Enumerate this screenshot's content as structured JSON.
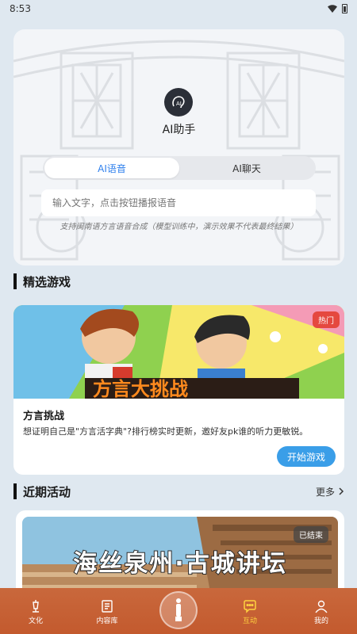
{
  "status": {
    "time": "8:53"
  },
  "ai": {
    "title": "AI助手",
    "tabs": [
      {
        "label": "AI语音",
        "active": true
      },
      {
        "label": "AI聊天",
        "active": false
      }
    ],
    "input_placeholder": "输入文字，点击按钮播报语音",
    "note": "支持闽南语方言语音合成（模型训练中，演示效果不代表最终结果）"
  },
  "games": {
    "section_title": "精选游戏",
    "badge": "热门",
    "banner_text": "方言大挑战",
    "title": "方言挑战",
    "desc": "想证明自己是\"方言活字典\"?排行榜实时更新，邀好友pk谁的听力更敏锐。",
    "button": "开始游戏"
  },
  "activities": {
    "section_title": "近期活动",
    "more": "更多",
    "badge": "已结束",
    "banner_title": "海丝泉州·古城讲坛"
  },
  "nav": {
    "items": [
      {
        "label": "文化",
        "icon": "culture-icon"
      },
      {
        "label": "内容库",
        "icon": "scroll-icon"
      },
      {
        "label": "",
        "icon": "statue-icon"
      },
      {
        "label": "互动",
        "icon": "chat-bubble-icon",
        "active": true
      },
      {
        "label": "我的",
        "icon": "profile-icon"
      }
    ]
  },
  "colors": {
    "accent": "#2f80ed",
    "button": "#3a9ee8",
    "nav_bg": "#c35a2e",
    "nav_active": "#ffd23f",
    "hot": "#e5483f"
  }
}
